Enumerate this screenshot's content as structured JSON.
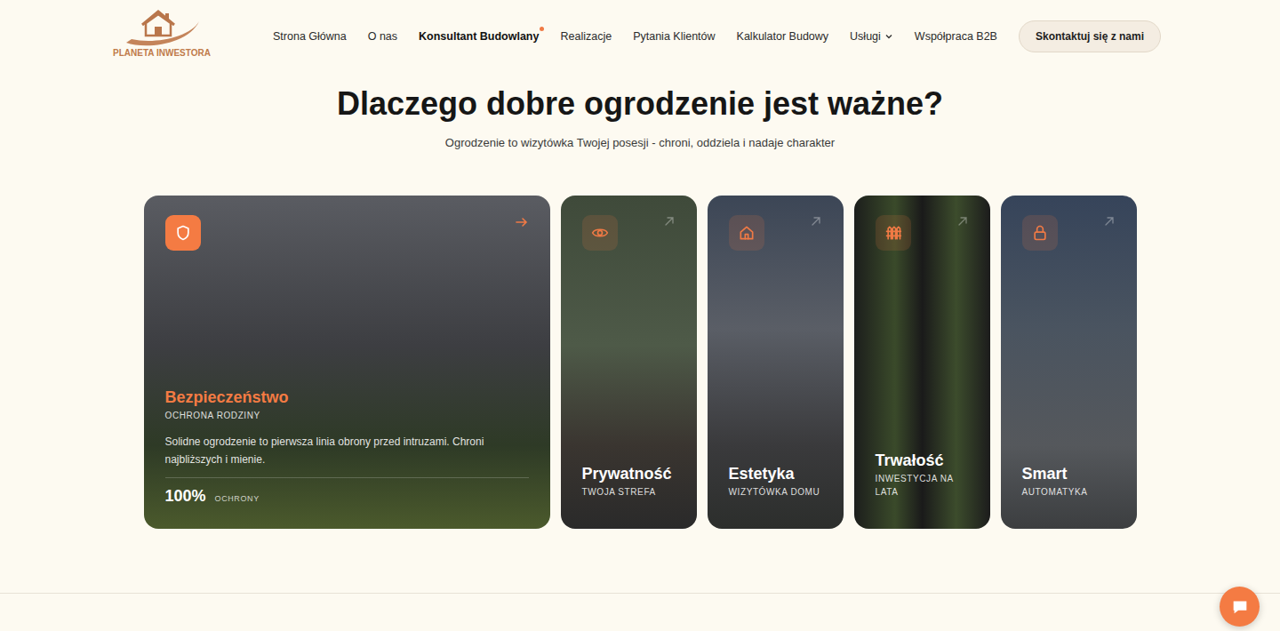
{
  "header": {
    "logo": {
      "text": "PLANETA INWESTORA"
    },
    "nav": [
      {
        "label": "Strona Główna",
        "selected": false,
        "has_badge": false,
        "has_dropdown": false
      },
      {
        "label": "O nas",
        "selected": false,
        "has_badge": false,
        "has_dropdown": false
      },
      {
        "label": "Konsultant Budowlany",
        "selected": true,
        "has_badge": true,
        "has_dropdown": false
      },
      {
        "label": "Realizacje",
        "selected": false,
        "has_badge": false,
        "has_dropdown": false
      },
      {
        "label": "Pytania Klientów",
        "selected": false,
        "has_badge": false,
        "has_dropdown": false
      },
      {
        "label": "Kalkulator Budowy",
        "selected": false,
        "has_badge": false,
        "has_dropdown": false
      },
      {
        "label": "Usługi",
        "selected": false,
        "has_badge": false,
        "has_dropdown": true
      },
      {
        "label": "Współpraca B2B",
        "selected": false,
        "has_badge": false,
        "has_dropdown": false
      }
    ],
    "contact_button": "Skontaktuj się z nami"
  },
  "section": {
    "title": "Dlaczego dobre ogrodzenie jest ważne?",
    "subtitle": "Ogrodzenie to wizytówka Twojej posesji - chroni, oddziela i nadaje charakter"
  },
  "cards": [
    {
      "title": "Bezpieczeństwo",
      "subtitle": "OCHRONA RODZINY",
      "expanded": true,
      "description": "Solidne ogrodzenie to pierwsza linia obrony przed intruzami. Chroni najbliższych i mienie.",
      "stat_value": "100%",
      "stat_label": "OCHRONY"
    },
    {
      "title": "Prywatność",
      "subtitle": "TWOJA STREFA",
      "expanded": false,
      "description": "",
      "stat_value": "",
      "stat_label": ""
    },
    {
      "title": "Estetyka",
      "subtitle": "WIZYTÓWKA DOMU",
      "expanded": false,
      "description": "",
      "stat_value": "",
      "stat_label": ""
    },
    {
      "title": "Trwałość",
      "subtitle": "INWESTYCJA NA LATA",
      "expanded": false,
      "description": "",
      "stat_value": "",
      "stat_label": ""
    },
    {
      "title": "Smart",
      "subtitle": "AUTOMATYKA",
      "expanded": false,
      "description": "",
      "stat_value": "",
      "stat_label": ""
    }
  ]
}
